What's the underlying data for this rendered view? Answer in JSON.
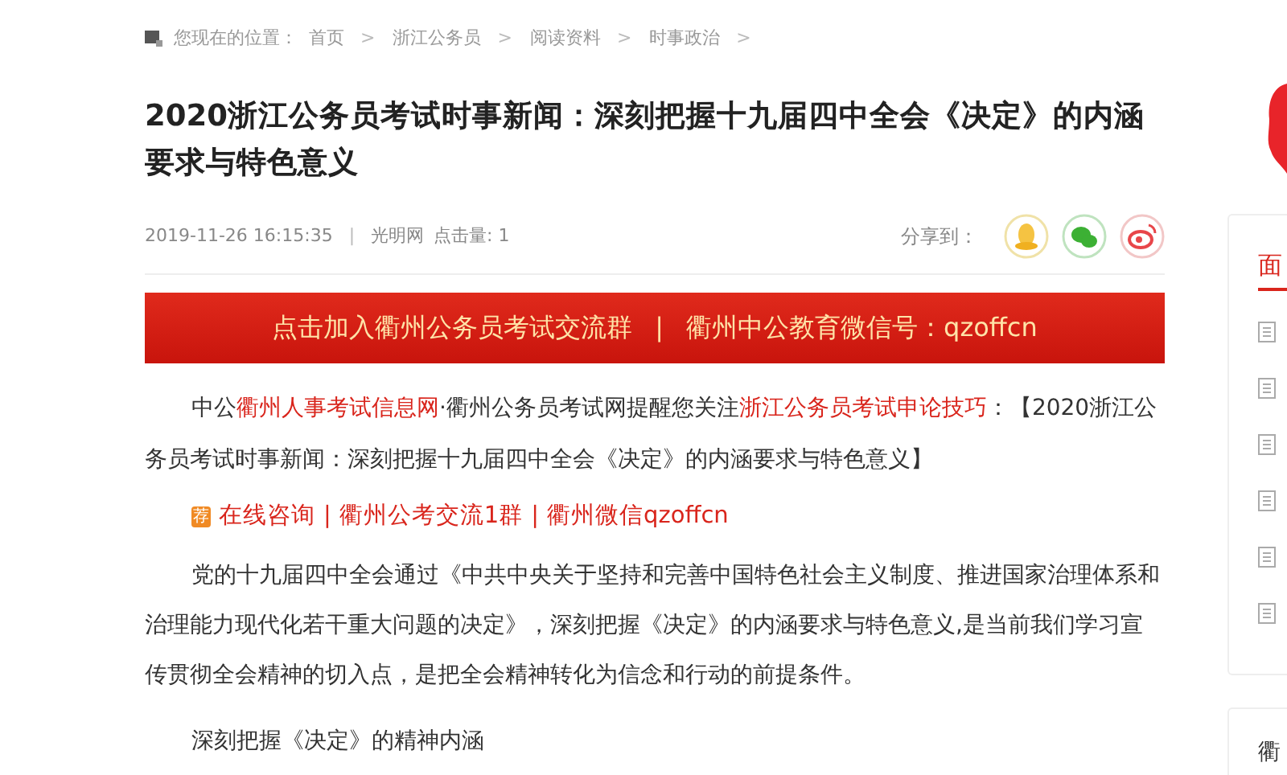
{
  "breadcrumb": {
    "label": "您现在的位置：",
    "items": [
      "首页",
      "浙江公务员",
      "阅读资料",
      "时事政治"
    ],
    "separator": ">"
  },
  "title": "2020浙江公务员考试时事新闻：深刻把握十九届四中全会《决定》的内涵要求与特色意义",
  "meta": {
    "datetime": "2019-11-26 16:15:35",
    "separator": "|",
    "source": "光明网",
    "clicks": "点击量: 1"
  },
  "share": {
    "label": "分享到："
  },
  "banner": {
    "left": "点击加入衢州公务员考试交流群",
    "separator": "|",
    "right": "衢州中公教育微信号：qzoffcn"
  },
  "intro": [
    {
      "text": "中公",
      "link": false
    },
    {
      "text": "衢州人事考试信息网",
      "link": true
    },
    {
      "text": "·衢州公务员考试网提醒您关注",
      "link": false
    },
    {
      "text": "浙江公务员考试申论技巧",
      "link": true
    },
    {
      "text": "：【2020浙江公务员考试时事新闻：深刻把握十九届四中全会《决定》的内涵要求与特色意义】",
      "link": false
    }
  ],
  "links": {
    "badge": "荐",
    "items": [
      "在线咨询",
      "衢州公考交流1群",
      "衢州微信qzoffcn"
    ],
    "separator": "|"
  },
  "paragraphs": [
    "党的十九届四中全会通过《中共中央关于坚持和完善中国特色社会主义制度、推进国家治理体系和治理能力现代化若干重大问题的决定》，深刻把握《决定》的内涵要求与特色意义,是当前我们学习宣传贯彻全会精神的切入点，是把全会精神转化为信念和行动的前提条件。",
    "深刻把握《决定》的精神内涵"
  ],
  "sidebar": {
    "tab": "面",
    "card_title": "衢"
  }
}
